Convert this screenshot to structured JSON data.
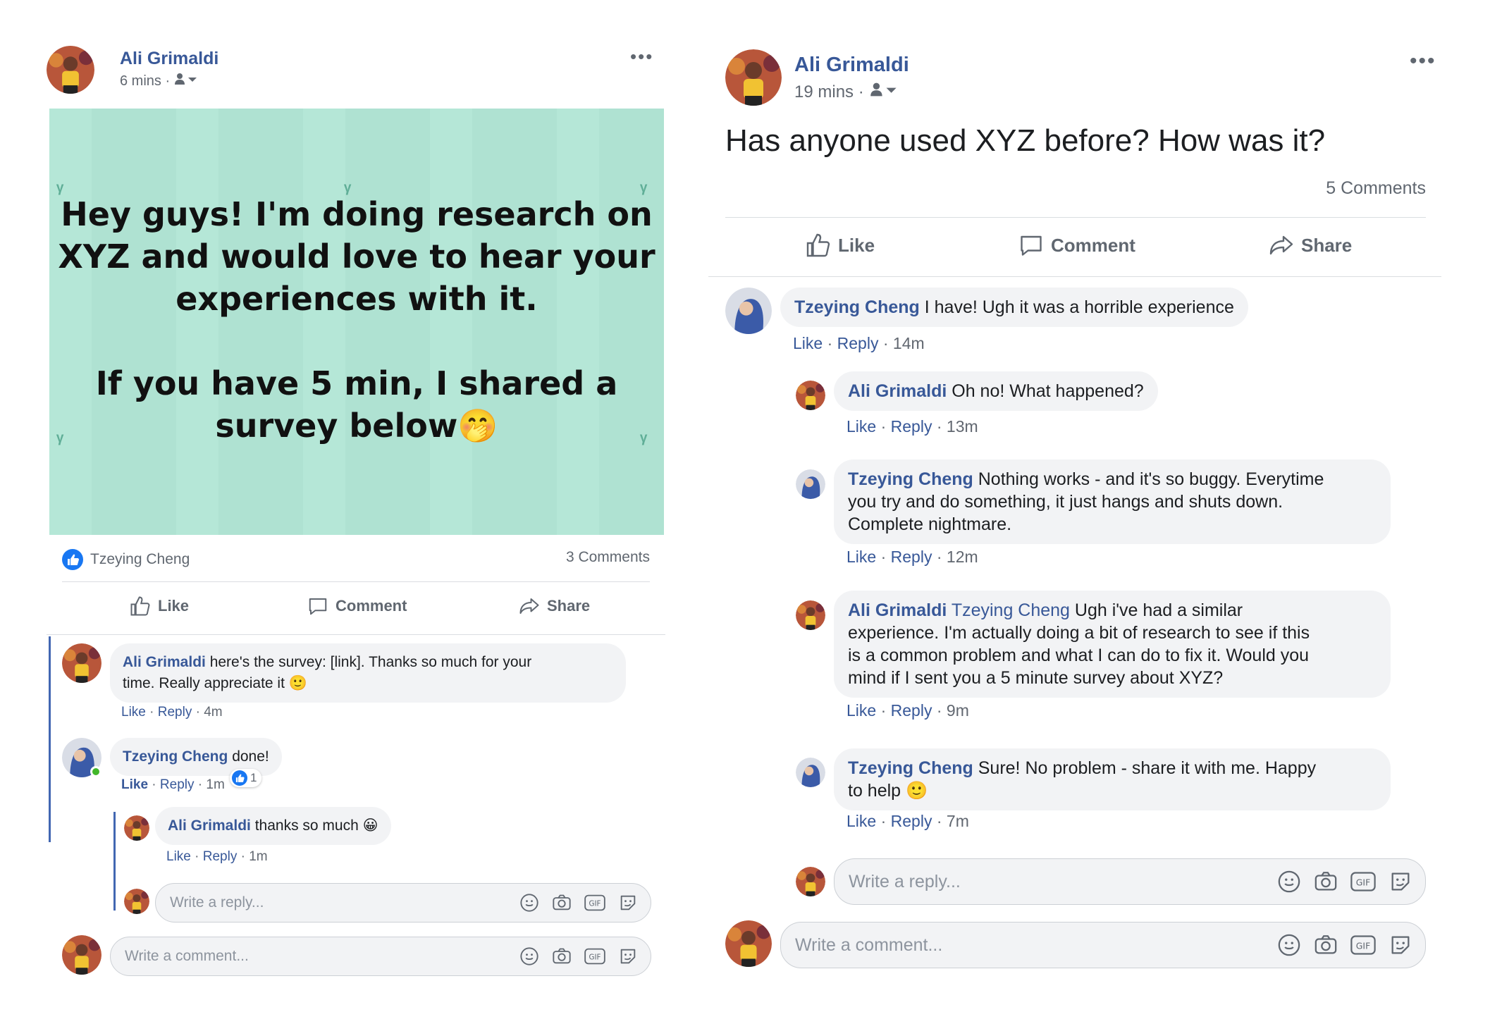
{
  "colors": {
    "link": "#385898",
    "banner_bg": "#b5e7d7",
    "thread_line": "#4267b2",
    "bubble_bg": "#f2f3f5",
    "online": "#42b72a"
  },
  "left_post": {
    "author": "Ali Grimaldi",
    "time": "6 mins ·",
    "audience_icon": "friends-icon",
    "more": "•••",
    "banner": {
      "line1": "Hey guys! I'm doing research on",
      "line2": "XYZ and would love to hear your",
      "line3": "experiences with it.",
      "line4": "If you have 5 min, I shared a",
      "line5": "survey below",
      "emoji": "🤭"
    },
    "reactions": {
      "icon": "like-reaction-icon",
      "names": "Tzeying Cheng"
    },
    "comments_count": "3 Comments",
    "actions": {
      "like": "Like",
      "comment": "Comment",
      "share": "Share"
    },
    "comments": [
      {
        "author": "Ali Grimaldi",
        "text": "here's the survey: [link]. Thanks so much for your",
        "text2": "time. Really appreciate it 🙂",
        "like": "Like",
        "reply": "Reply",
        "time": "4m"
      },
      {
        "author": "Tzeying Cheng",
        "text": "done!",
        "like": "Like",
        "reply": "Reply",
        "time": "1m",
        "reaction_count": "1"
      },
      {
        "author": "Ali Grimaldi",
        "text": "thanks so much 😀",
        "like": "Like",
        "reply": "Reply",
        "time": "1m"
      }
    ],
    "reply_placeholder": "Write a reply...",
    "comment_placeholder": "Write a comment..."
  },
  "right_post": {
    "author": "Ali Grimaldi",
    "time": "19 mins ·",
    "audience_icon": "friends-icon",
    "more": "•••",
    "question": "Has anyone used XYZ before? How was it?",
    "comments_count": "5 Comments",
    "actions": {
      "like": "Like",
      "comment": "Comment",
      "share": "Share"
    },
    "comments": [
      {
        "author": "Tzeying Cheng",
        "text": "I have! Ugh it was a horrible experience",
        "like": "Like",
        "reply": "Reply",
        "time": "14m"
      },
      {
        "author": "Ali Grimaldi",
        "text": "Oh no! What happened?",
        "like": "Like",
        "reply": "Reply",
        "time": "13m"
      },
      {
        "author": "Tzeying Cheng",
        "text": "Nothing works - and it's so buggy. Everytime",
        "text2": "you try and do something, it just hangs and shuts down.",
        "text3": "Complete nightmare.",
        "like": "Like",
        "reply": "Reply",
        "time": "12m"
      },
      {
        "author": "Ali Grimaldi",
        "mention": "Tzeying Cheng",
        "text": "Ugh i've had a similar",
        "text2": "experience. I'm actually doing a bit of research to see if this",
        "text3": "is a common problem and what I can do to fix it. Would you",
        "text4": "mind if I sent you a 5 minute survey about XYZ?",
        "like": "Like",
        "reply": "Reply",
        "time": "9m"
      },
      {
        "author": "Tzeying Cheng",
        "text": "Sure! No problem - share it with me. Happy",
        "text2": "to help 🙂",
        "like": "Like",
        "reply": "Reply",
        "time": "7m"
      }
    ],
    "reply_placeholder": "Write a reply...",
    "comment_placeholder": "Write a comment..."
  }
}
